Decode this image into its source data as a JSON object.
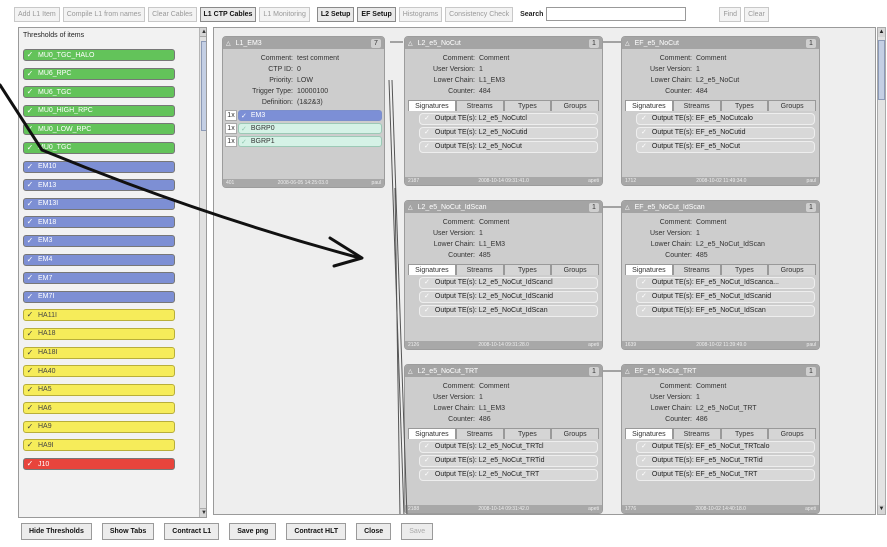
{
  "toolbar": {
    "add_l1_item": "Add L1 Item",
    "compile_l1": "Compile L1 from names",
    "clear_cables": "Clear Cables",
    "l1_ctp_cables": "L1 CTP Cables",
    "l1_monitoring": "L1 Monitoring",
    "l2_setup": "L2 Setup",
    "ef_setup": "EF Setup",
    "histograms": "Histograms",
    "consistency_check": "Consistency Check",
    "search_label": "Search",
    "search_value": "",
    "find": "Find",
    "clear": "Clear"
  },
  "thresholds": {
    "title": "Thresholds of items",
    "check_icon": "check-icon",
    "items": [
      {
        "label": "MU0_TGC_HALO",
        "color": "#63c35a"
      },
      {
        "label": "MU6_RPC",
        "color": "#63c35a"
      },
      {
        "label": "MU6_TGC",
        "color": "#63c35a"
      },
      {
        "label": "MU0_HIGH_RPC",
        "color": "#63c35a"
      },
      {
        "label": "MU0_LOW_RPC",
        "color": "#63c35a"
      },
      {
        "label": "MU0_TGC",
        "color": "#63c35a"
      },
      {
        "label": "EM10",
        "color": "#7d8fd4"
      },
      {
        "label": "EM13",
        "color": "#7d8fd4"
      },
      {
        "label": "EM13I",
        "color": "#7d8fd4"
      },
      {
        "label": "EM18",
        "color": "#7d8fd4"
      },
      {
        "label": "EM3",
        "color": "#7d8fd4"
      },
      {
        "label": "EM4",
        "color": "#7d8fd4"
      },
      {
        "label": "EM7",
        "color": "#7d8fd4"
      },
      {
        "label": "EM7I",
        "color": "#7d8fd4"
      },
      {
        "label": "HA11I",
        "color": "#f6ec5a"
      },
      {
        "label": "HA18",
        "color": "#f6ec5a"
      },
      {
        "label": "HA18I",
        "color": "#f6ec5a"
      },
      {
        "label": "HA40",
        "color": "#f6ec5a"
      },
      {
        "label": "HA5",
        "color": "#f6ec5a"
      },
      {
        "label": "HA6",
        "color": "#f6ec5a"
      },
      {
        "label": "HA9",
        "color": "#f6ec5a"
      },
      {
        "label": "HA9I",
        "color": "#f6ec5a"
      },
      {
        "label": "J10",
        "color": "#e8443c"
      }
    ]
  },
  "l1_item": {
    "name": "L1_EM3",
    "count": "7",
    "rows": [
      {
        "k": "Comment:",
        "v": "test comment"
      },
      {
        "k": "CTP ID:",
        "v": "0"
      },
      {
        "k": "Priority:",
        "v": "LOW"
      },
      {
        "k": "Trigger Type:",
        "v": "10000100"
      },
      {
        "k": "Definition:",
        "v": "(1&2&3)"
      }
    ],
    "items": [
      {
        "mult": "1x",
        "label": "EM3"
      },
      {
        "mult": "1x",
        "label": "BGRP0"
      },
      {
        "mult": "1x",
        "label": "BGRP1"
      }
    ],
    "footer_left": "401",
    "footer_mid": "2008-06-05 14:25:03.0",
    "footer_right": "paul"
  },
  "chain_tabs": [
    "Signatures",
    "Streams",
    "Types",
    "Groups"
  ],
  "chains": [
    {
      "name": "L2_e5_NoCut",
      "count": "1",
      "rows": [
        {
          "k": "Comment:",
          "v": "Comment"
        },
        {
          "k": "User Version:",
          "v": "1"
        },
        {
          "k": "Lower Chain:",
          "v": "L1_EM3"
        },
        {
          "k": "Counter:",
          "v": "484"
        }
      ],
      "outputs": [
        "Output TE(s): L2_e5_NoCutcl",
        "Output TE(s): L2_e5_NoCutid",
        "Output TE(s): L2_e5_NoCut"
      ],
      "footer_left": "2187",
      "footer_mid": "2008-10-14 09:31:41.0",
      "footer_right": "apeti"
    },
    {
      "name": "EF_e5_NoCut",
      "count": "1",
      "rows": [
        {
          "k": "Comment:",
          "v": "Comment"
        },
        {
          "k": "User Version:",
          "v": "1"
        },
        {
          "k": "Lower Chain:",
          "v": "L2_e5_NoCut"
        },
        {
          "k": "Counter:",
          "v": "484"
        }
      ],
      "outputs": [
        "Output TE(s): EF_e5_NoCutcalo",
        "Output TE(s): EF_e5_NoCutid",
        "Output TE(s): EF_e5_NoCut"
      ],
      "footer_left": "1712",
      "footer_mid": "2008-10-02 11:49:34.0",
      "footer_right": "paul"
    },
    {
      "name": "L2_e5_NoCut_IdScan",
      "count": "1",
      "rows": [
        {
          "k": "Comment:",
          "v": "Comment"
        },
        {
          "k": "User Version:",
          "v": "1"
        },
        {
          "k": "Lower Chain:",
          "v": "L1_EM3"
        },
        {
          "k": "Counter:",
          "v": "485"
        }
      ],
      "outputs": [
        "Output TE(s): L2_e5_NoCut_IdScancl",
        "Output TE(s): L2_e5_NoCut_IdScanid",
        "Output TE(s): L2_e5_NoCut_IdScan"
      ],
      "footer_left": "2126",
      "footer_mid": "2008-10-14 09:31:28.0",
      "footer_right": "apeti"
    },
    {
      "name": "EF_e5_NoCut_IdScan",
      "count": "1",
      "rows": [
        {
          "k": "Comment:",
          "v": "Comment"
        },
        {
          "k": "User Version:",
          "v": "1"
        },
        {
          "k": "Lower Chain:",
          "v": "L2_e5_NoCut_IdScan"
        },
        {
          "k": "Counter:",
          "v": "485"
        }
      ],
      "outputs": [
        "Output TE(s): EF_e5_NoCut_IdScanca...",
        "Output TE(s): EF_e5_NoCut_IdScanid",
        "Output TE(s): EF_e5_NoCut_IdScan"
      ],
      "footer_left": "1639",
      "footer_mid": "2008-10-02 11:39:49.0",
      "footer_right": "paul"
    },
    {
      "name": "L2_e5_NoCut_TRT",
      "count": "1",
      "rows": [
        {
          "k": "Comment:",
          "v": "Comment"
        },
        {
          "k": "User Version:",
          "v": "1"
        },
        {
          "k": "Lower Chain:",
          "v": "L1_EM3"
        },
        {
          "k": "Counter:",
          "v": "486"
        }
      ],
      "outputs": [
        "Output TE(s): L2_e5_NoCut_TRTcl",
        "Output TE(s): L2_e5_NoCut_TRTid",
        "Output TE(s): L2_e5_NoCut_TRT"
      ],
      "footer_left": "2188",
      "footer_mid": "2008-10-14 09:31:42.0",
      "footer_right": "apeti"
    },
    {
      "name": "EF_e5_NoCut_TRT",
      "count": "1",
      "rows": [
        {
          "k": "Comment:",
          "v": "Comment"
        },
        {
          "k": "User Version:",
          "v": "1"
        },
        {
          "k": "Lower Chain:",
          "v": "L2_e5_NoCut_TRT"
        },
        {
          "k": "Counter:",
          "v": "486"
        }
      ],
      "outputs": [
        "Output TE(s): EF_e5_NoCut_TRTcalo",
        "Output TE(s): EF_e5_NoCut_TRTid",
        "Output TE(s): EF_e5_NoCut_TRT"
      ],
      "footer_left": "1776",
      "footer_mid": "2008-10-02 14:40:18.0",
      "footer_right": "apeti"
    }
  ],
  "bottom": {
    "hide_thresholds": "Hide Thresholds",
    "show_tabs": "Show Tabs",
    "contract_l1": "Contract L1",
    "save_png": "Save png",
    "contract_hlt": "Contract HLT",
    "close": "Close",
    "save": "Save"
  },
  "icons": {
    "collapse": "triangle-up-icon",
    "check": "check-icon",
    "scroll_up": "arrow-up-icon",
    "scroll_down": "arrow-down-icon"
  }
}
